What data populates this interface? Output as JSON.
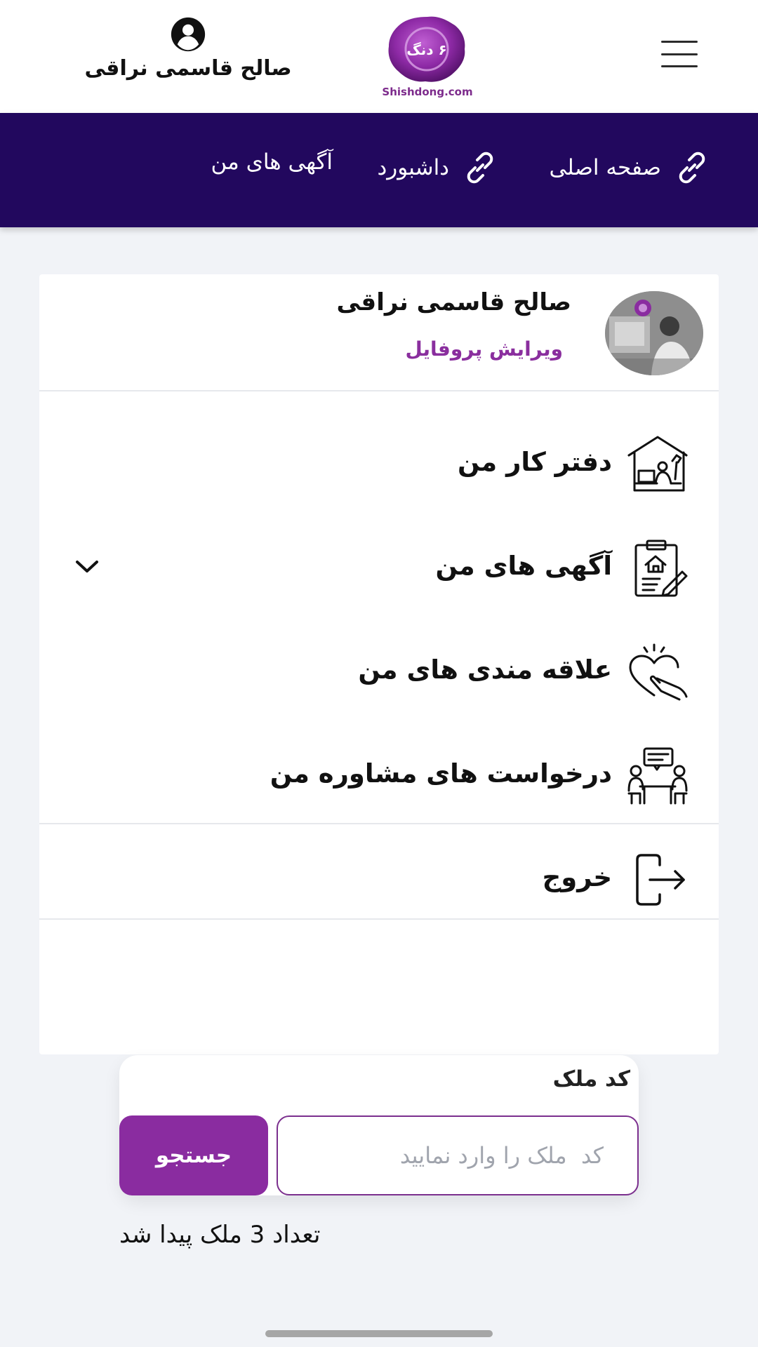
{
  "header": {
    "user_name": "صالح قاسمی نراقی",
    "logo_text": "۶ دنگ",
    "logo_caption": "Shishdong.com"
  },
  "nav": {
    "items": [
      {
        "label": "صفحه اصلی"
      },
      {
        "label": "داشبورد"
      },
      {
        "label": "آگهی های من"
      }
    ]
  },
  "profile": {
    "name": "صالح قاسمی نراقی",
    "edit_label": "ویرایش پروفایل"
  },
  "menu": {
    "items": [
      {
        "label": "دفتر کار من",
        "icon": "office-icon"
      },
      {
        "label": "آگهی های من",
        "icon": "listing-clipboard-icon",
        "expandable": true
      },
      {
        "label": "علاقه مندی های من",
        "icon": "heart-hand-icon"
      },
      {
        "label": "درخواست های مشاوره من",
        "icon": "consultation-icon"
      }
    ],
    "logout_label": "خروج"
  },
  "search": {
    "title": "کد ملک",
    "placeholder": "کد  ملک را وارد نمایید",
    "button_label": "جستجو"
  },
  "results": {
    "count_text": "تعداد 3 ملک پیدا شد"
  },
  "colors": {
    "navbar": "#22085e",
    "accent": "#8a2ca0",
    "background": "#f1f3f7"
  }
}
